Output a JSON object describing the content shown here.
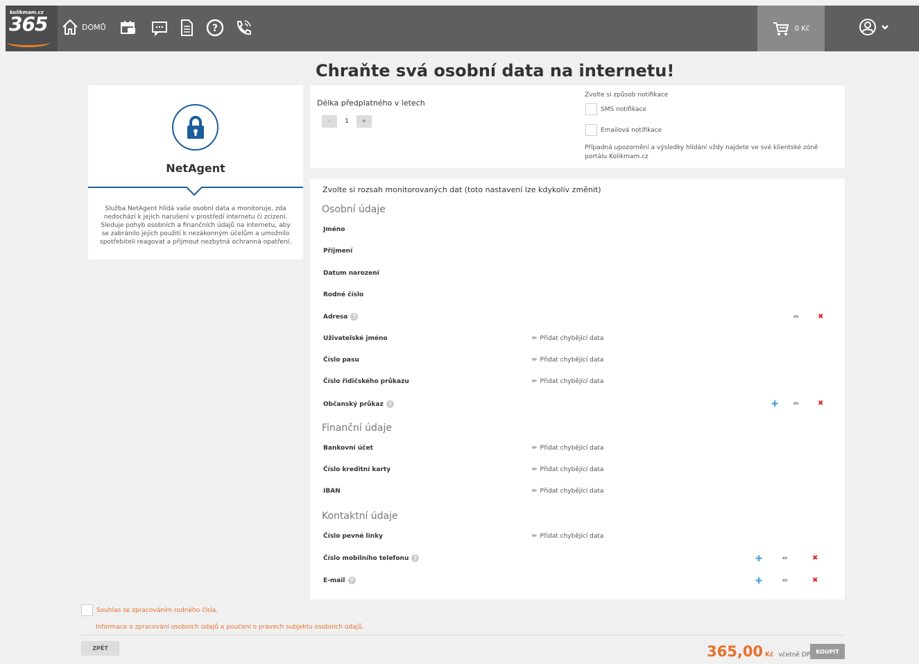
{
  "header": {
    "logo_small": "kolikmam.cz",
    "logo_num": "365",
    "home_label": "DOMŮ",
    "cart_value": "0 Kč"
  },
  "page_title": "Chraňte svá osobní data na internetu!",
  "product": {
    "name": "NetAgent",
    "description": "Služba NetAgent hlídá vaše osobní data a monitoruje, zda nedochází k jejich narušení v prostředí internetu či zcizení. Sleduje pohyb osobních a finančních údajů na internetu, aby se zabránilo jejich použití k nezákonným účelům a umožnilo spotřebiteli reagovat a přijmout nezbytná ochranná opatření."
  },
  "subscription": {
    "label": "Délka předplatného v letech",
    "minus": "-",
    "value": "1",
    "plus": "+",
    "notif_label": "Zvolte si způsob notifikace",
    "sms": "SMS notifikace",
    "email": "Emailová notifikace",
    "info": "Případná upozornění a výsledky hlídání vždy najdete ve své klientské zóně portálu Kolikmam.cz"
  },
  "data": {
    "scope_label": "Zvolte si rozsah monitorovaných dat (toto nastavení lze kdykoliv změnit)",
    "add_missing": "Přidat chybějící data",
    "sections": {
      "personal": "Osobní údaje",
      "financial": "Finanční údaje",
      "contact": "Kontaktní údaje"
    },
    "rows": {
      "jmeno": "Jméno",
      "prijmeni": "Příjmení",
      "datum": "Datum narození",
      "rodne": "Rodné číslo",
      "adresa": "Adresa",
      "uziv": "Uživatelské jméno",
      "pas": "Číslo pasu",
      "ridic": "Číslo řidičského průkazu",
      "op": "Občanský průkaz",
      "banka": "Bankovní účet",
      "karta": "Číslo kreditní karty",
      "iban": "IBAN",
      "pevna": "Číslo pevné linky",
      "mobil": "Číslo mobilního telefonu",
      "email": "E-mail"
    },
    "help_mark": "?"
  },
  "footer": {
    "consent": "Souhlas se zpracováním rodného čísla.",
    "info_link": "Informace o zpracování osobních údajů a poučení o právech subjektu osobních údajů.",
    "back": "ZPĚT",
    "price": "365,00",
    "currency": "Kč",
    "vat": "včetně DPH",
    "buy": "KOUPIT"
  },
  "colors": {
    "accent": "#e8702a",
    "blue": "#1a5e9c",
    "topbar": "#5f5f5f"
  }
}
